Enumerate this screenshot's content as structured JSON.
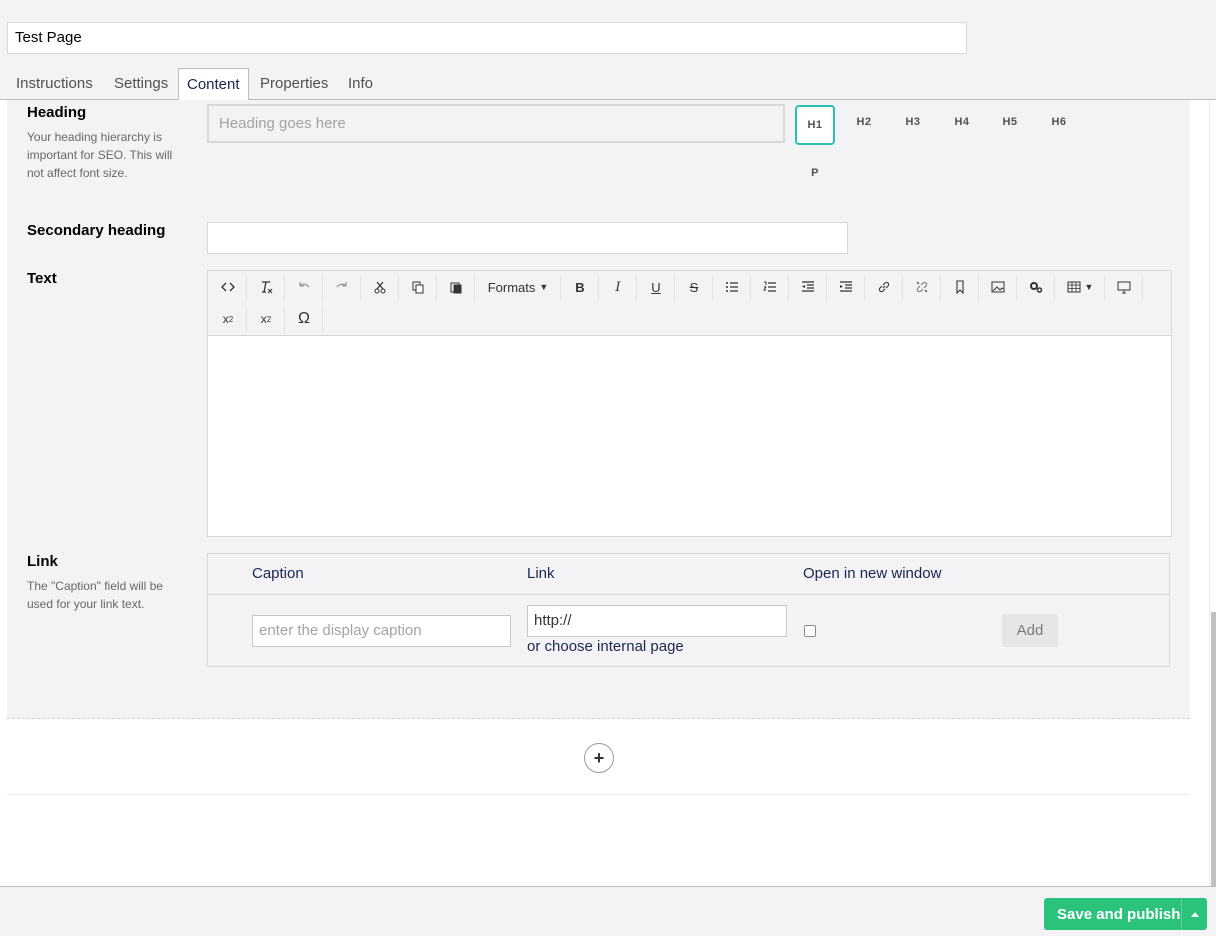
{
  "name": {
    "value": "Test Page"
  },
  "tabs": [
    {
      "label": "Instructions"
    },
    {
      "label": "Settings"
    },
    {
      "label": "Content"
    },
    {
      "label": "Properties"
    },
    {
      "label": "Info"
    }
  ],
  "heading": {
    "label": "Heading",
    "description": "Your heading hierarchy is important for SEO. This will not affect font size.",
    "placeholder": "Heading goes here",
    "levels": [
      "H1",
      "H2",
      "H3",
      "H4",
      "H5",
      "H6",
      "P"
    ],
    "selected": "H1"
  },
  "secondary_heading": {
    "label": "Secondary heading",
    "value": ""
  },
  "text": {
    "label": "Text",
    "toolbar": {
      "formats_label": "Formats",
      "icons": [
        "source-code-icon",
        "clear-format-icon",
        "undo-icon",
        "redo-icon",
        "cut-icon",
        "copy-icon",
        "paste-icon",
        "formats-dropdown",
        "bold-icon",
        "italic-icon",
        "underline-icon",
        "strikethrough-icon",
        "bullet-list-icon",
        "numbered-list-icon",
        "outdent-icon",
        "indent-icon",
        "link-icon",
        "unlink-icon",
        "anchor-icon",
        "image-icon",
        "macro-icon",
        "table-icon",
        "preview-icon",
        "subscript-icon",
        "superscript-icon",
        "special-char-icon"
      ]
    }
  },
  "link": {
    "label": "Link",
    "description": "The \"Caption\" field will be used for your link text.",
    "columns": {
      "caption": "Caption",
      "link": "Link",
      "new_window": "Open in new window"
    },
    "caption_placeholder": "enter the display caption",
    "link_value": "http://",
    "choose_internal": "or choose internal page",
    "add_label": "Add"
  },
  "footer": {
    "publish_label": "Save and publish"
  },
  "colors": {
    "accent": "#2bc0b5",
    "publish": "#2bc37c",
    "text": "#1b264f"
  }
}
